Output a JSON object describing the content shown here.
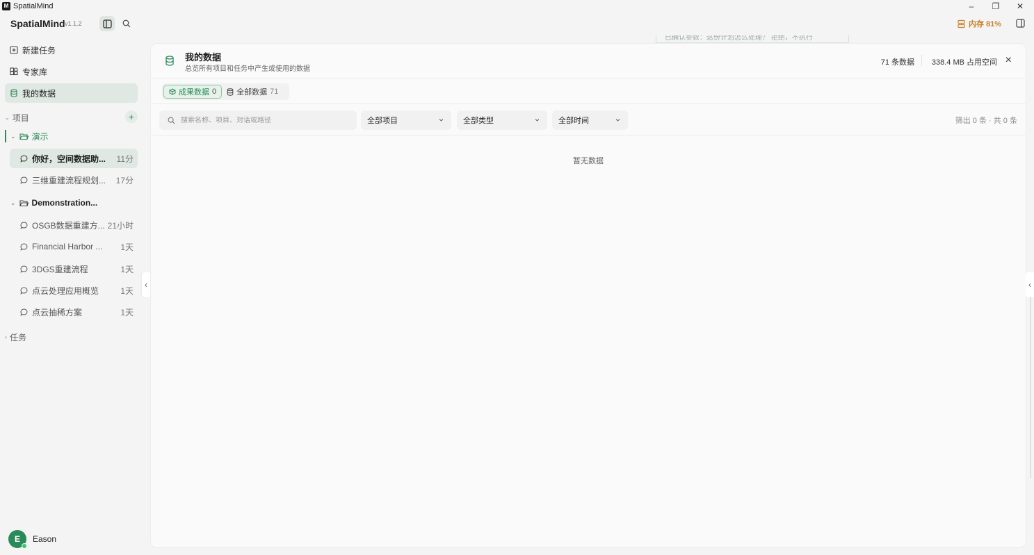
{
  "window": {
    "title": "SpatialMind",
    "logo_text": "M",
    "controls": {
      "minimize": "–",
      "restore": "❐",
      "close": "✕"
    }
  },
  "header": {
    "app_name": "SpatialMind",
    "version": "v1.1.2",
    "memory": "内存 81%"
  },
  "sidebar": {
    "nav": [
      {
        "label": "新建任务",
        "icon": "new-task-icon"
      },
      {
        "label": "专家库",
        "icon": "expert-library-icon"
      },
      {
        "label": "我的数据",
        "icon": "database-icon",
        "active": true
      }
    ],
    "projects_label": "项目",
    "add_symbol": "+",
    "folders": [
      {
        "name": "演示",
        "conversations": [
          {
            "title": "你好，空间数据助...",
            "time": "11分",
            "active": true
          },
          {
            "title": "三维重建流程规划...",
            "time": "17分"
          }
        ]
      },
      {
        "name": "Demonstration...",
        "conversations": [
          {
            "title": "OSGB数据重建方...",
            "time": "21小时"
          },
          {
            "title": "Financial Harbor ...",
            "time": "1天"
          },
          {
            "title": "3DGS重建流程",
            "time": "1天"
          },
          {
            "title": "点云处理应用概览",
            "time": "1天"
          },
          {
            "title": "点云抽稀方案",
            "time": "1天"
          }
        ]
      }
    ],
    "tasks_label": "任务",
    "user": {
      "initial": "E",
      "name": "Eason"
    }
  },
  "background_tooltip": "已确认参数：这份计划怎么处理？ 拒绝，不执行",
  "main": {
    "title": "我的数据",
    "subtitle": "总览所有项目和任务中产生或使用的数据",
    "data_count": "71 条数据",
    "storage": "338.4 MB 占用空间",
    "close_symbol": "×",
    "tabs": [
      {
        "label": "成果数据",
        "count": "0",
        "active": true
      },
      {
        "label": "全部数据",
        "count": "71"
      }
    ],
    "search": {
      "placeholder": "搜索名称、项目、对话或路径",
      "value": ""
    },
    "filters": {
      "project": "全部项目",
      "type": "全部类型",
      "time": "全部时间"
    },
    "filter_result": "筛出 0 条 · 共 0 条",
    "empty_text": "暂无数据"
  },
  "colors": {
    "accent": "#2b8a5a",
    "memory_warning": "#c9812d",
    "active_bg": "#dfe8e3"
  }
}
